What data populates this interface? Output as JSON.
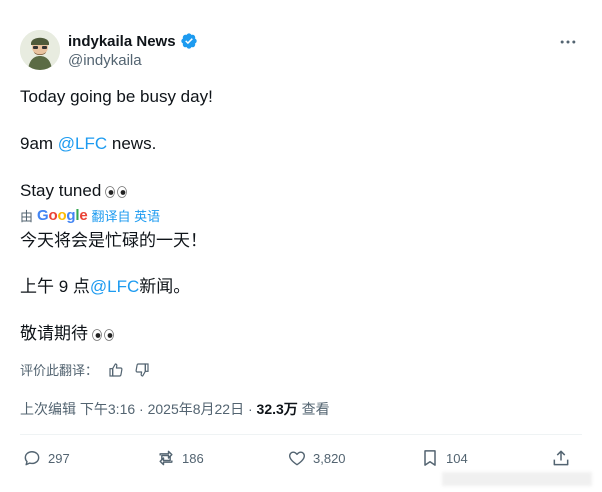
{
  "author": {
    "name": "indykaila News",
    "handle": "@indykaila"
  },
  "tweet": {
    "line1": "Today going be busy day!",
    "line2_prefix": "9am ",
    "line2_mention": "@LFC",
    "line2_suffix": " news.",
    "line3": "Stay tuned"
  },
  "translation": {
    "by_prefix": "由",
    "google_letters": [
      "G",
      "o",
      "o",
      "g",
      "l",
      "e"
    ],
    "translated_from": "翻译自 英语",
    "line1": "今天将会是忙碌的一天！",
    "line2_prefix": "上午 9 点",
    "line2_mention": "@LFC",
    "line2_suffix": "新闻。",
    "line3": "敬请期待"
  },
  "rate": {
    "label": "评价此翻译："
  },
  "meta": {
    "edited": "上次编辑",
    "time": "下午3:16 · 2025年8月22日 · ",
    "views_count": "32.3万",
    "views_label": " 查看"
  },
  "actions": {
    "replies": "297",
    "reposts": "186",
    "likes": "3,820",
    "bookmarks": "104"
  },
  "colors": {
    "text": "#0f1419",
    "muted": "#536471",
    "link": "#1d9bf0",
    "verified": "#1d9bf0"
  }
}
